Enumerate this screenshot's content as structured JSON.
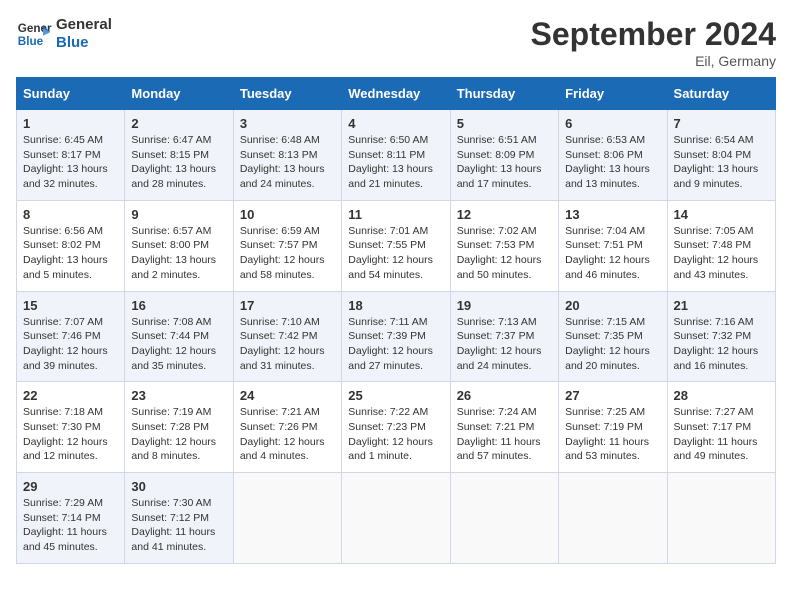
{
  "header": {
    "logo_line1": "General",
    "logo_line2": "Blue",
    "month": "September 2024",
    "location": "Eil, Germany"
  },
  "days_of_week": [
    "Sunday",
    "Monday",
    "Tuesday",
    "Wednesday",
    "Thursday",
    "Friday",
    "Saturday"
  ],
  "weeks": [
    [
      {
        "day": "1",
        "lines": [
          "Sunrise: 6:45 AM",
          "Sunset: 8:17 PM",
          "Daylight: 13 hours",
          "and 32 minutes."
        ]
      },
      {
        "day": "2",
        "lines": [
          "Sunrise: 6:47 AM",
          "Sunset: 8:15 PM",
          "Daylight: 13 hours",
          "and 28 minutes."
        ]
      },
      {
        "day": "3",
        "lines": [
          "Sunrise: 6:48 AM",
          "Sunset: 8:13 PM",
          "Daylight: 13 hours",
          "and 24 minutes."
        ]
      },
      {
        "day": "4",
        "lines": [
          "Sunrise: 6:50 AM",
          "Sunset: 8:11 PM",
          "Daylight: 13 hours",
          "and 21 minutes."
        ]
      },
      {
        "day": "5",
        "lines": [
          "Sunrise: 6:51 AM",
          "Sunset: 8:09 PM",
          "Daylight: 13 hours",
          "and 17 minutes."
        ]
      },
      {
        "day": "6",
        "lines": [
          "Sunrise: 6:53 AM",
          "Sunset: 8:06 PM",
          "Daylight: 13 hours",
          "and 13 minutes."
        ]
      },
      {
        "day": "7",
        "lines": [
          "Sunrise: 6:54 AM",
          "Sunset: 8:04 PM",
          "Daylight: 13 hours",
          "and 9 minutes."
        ]
      }
    ],
    [
      {
        "day": "8",
        "lines": [
          "Sunrise: 6:56 AM",
          "Sunset: 8:02 PM",
          "Daylight: 13 hours",
          "and 5 minutes."
        ]
      },
      {
        "day": "9",
        "lines": [
          "Sunrise: 6:57 AM",
          "Sunset: 8:00 PM",
          "Daylight: 13 hours",
          "and 2 minutes."
        ]
      },
      {
        "day": "10",
        "lines": [
          "Sunrise: 6:59 AM",
          "Sunset: 7:57 PM",
          "Daylight: 12 hours",
          "and 58 minutes."
        ]
      },
      {
        "day": "11",
        "lines": [
          "Sunrise: 7:01 AM",
          "Sunset: 7:55 PM",
          "Daylight: 12 hours",
          "and 54 minutes."
        ]
      },
      {
        "day": "12",
        "lines": [
          "Sunrise: 7:02 AM",
          "Sunset: 7:53 PM",
          "Daylight: 12 hours",
          "and 50 minutes."
        ]
      },
      {
        "day": "13",
        "lines": [
          "Sunrise: 7:04 AM",
          "Sunset: 7:51 PM",
          "Daylight: 12 hours",
          "and 46 minutes."
        ]
      },
      {
        "day": "14",
        "lines": [
          "Sunrise: 7:05 AM",
          "Sunset: 7:48 PM",
          "Daylight: 12 hours",
          "and 43 minutes."
        ]
      }
    ],
    [
      {
        "day": "15",
        "lines": [
          "Sunrise: 7:07 AM",
          "Sunset: 7:46 PM",
          "Daylight: 12 hours",
          "and 39 minutes."
        ]
      },
      {
        "day": "16",
        "lines": [
          "Sunrise: 7:08 AM",
          "Sunset: 7:44 PM",
          "Daylight: 12 hours",
          "and 35 minutes."
        ]
      },
      {
        "day": "17",
        "lines": [
          "Sunrise: 7:10 AM",
          "Sunset: 7:42 PM",
          "Daylight: 12 hours",
          "and 31 minutes."
        ]
      },
      {
        "day": "18",
        "lines": [
          "Sunrise: 7:11 AM",
          "Sunset: 7:39 PM",
          "Daylight: 12 hours",
          "and 27 minutes."
        ]
      },
      {
        "day": "19",
        "lines": [
          "Sunrise: 7:13 AM",
          "Sunset: 7:37 PM",
          "Daylight: 12 hours",
          "and 24 minutes."
        ]
      },
      {
        "day": "20",
        "lines": [
          "Sunrise: 7:15 AM",
          "Sunset: 7:35 PM",
          "Daylight: 12 hours",
          "and 20 minutes."
        ]
      },
      {
        "day": "21",
        "lines": [
          "Sunrise: 7:16 AM",
          "Sunset: 7:32 PM",
          "Daylight: 12 hours",
          "and 16 minutes."
        ]
      }
    ],
    [
      {
        "day": "22",
        "lines": [
          "Sunrise: 7:18 AM",
          "Sunset: 7:30 PM",
          "Daylight: 12 hours",
          "and 12 minutes."
        ]
      },
      {
        "day": "23",
        "lines": [
          "Sunrise: 7:19 AM",
          "Sunset: 7:28 PM",
          "Daylight: 12 hours",
          "and 8 minutes."
        ]
      },
      {
        "day": "24",
        "lines": [
          "Sunrise: 7:21 AM",
          "Sunset: 7:26 PM",
          "Daylight: 12 hours",
          "and 4 minutes."
        ]
      },
      {
        "day": "25",
        "lines": [
          "Sunrise: 7:22 AM",
          "Sunset: 7:23 PM",
          "Daylight: 12 hours",
          "and 1 minute."
        ]
      },
      {
        "day": "26",
        "lines": [
          "Sunrise: 7:24 AM",
          "Sunset: 7:21 PM",
          "Daylight: 11 hours",
          "and 57 minutes."
        ]
      },
      {
        "day": "27",
        "lines": [
          "Sunrise: 7:25 AM",
          "Sunset: 7:19 PM",
          "Daylight: 11 hours",
          "and 53 minutes."
        ]
      },
      {
        "day": "28",
        "lines": [
          "Sunrise: 7:27 AM",
          "Sunset: 7:17 PM",
          "Daylight: 11 hours",
          "and 49 minutes."
        ]
      }
    ],
    [
      {
        "day": "29",
        "lines": [
          "Sunrise: 7:29 AM",
          "Sunset: 7:14 PM",
          "Daylight: 11 hours",
          "and 45 minutes."
        ]
      },
      {
        "day": "30",
        "lines": [
          "Sunrise: 7:30 AM",
          "Sunset: 7:12 PM",
          "Daylight: 11 hours",
          "and 41 minutes."
        ]
      },
      {
        "day": "",
        "lines": []
      },
      {
        "day": "",
        "lines": []
      },
      {
        "day": "",
        "lines": []
      },
      {
        "day": "",
        "lines": []
      },
      {
        "day": "",
        "lines": []
      }
    ]
  ]
}
